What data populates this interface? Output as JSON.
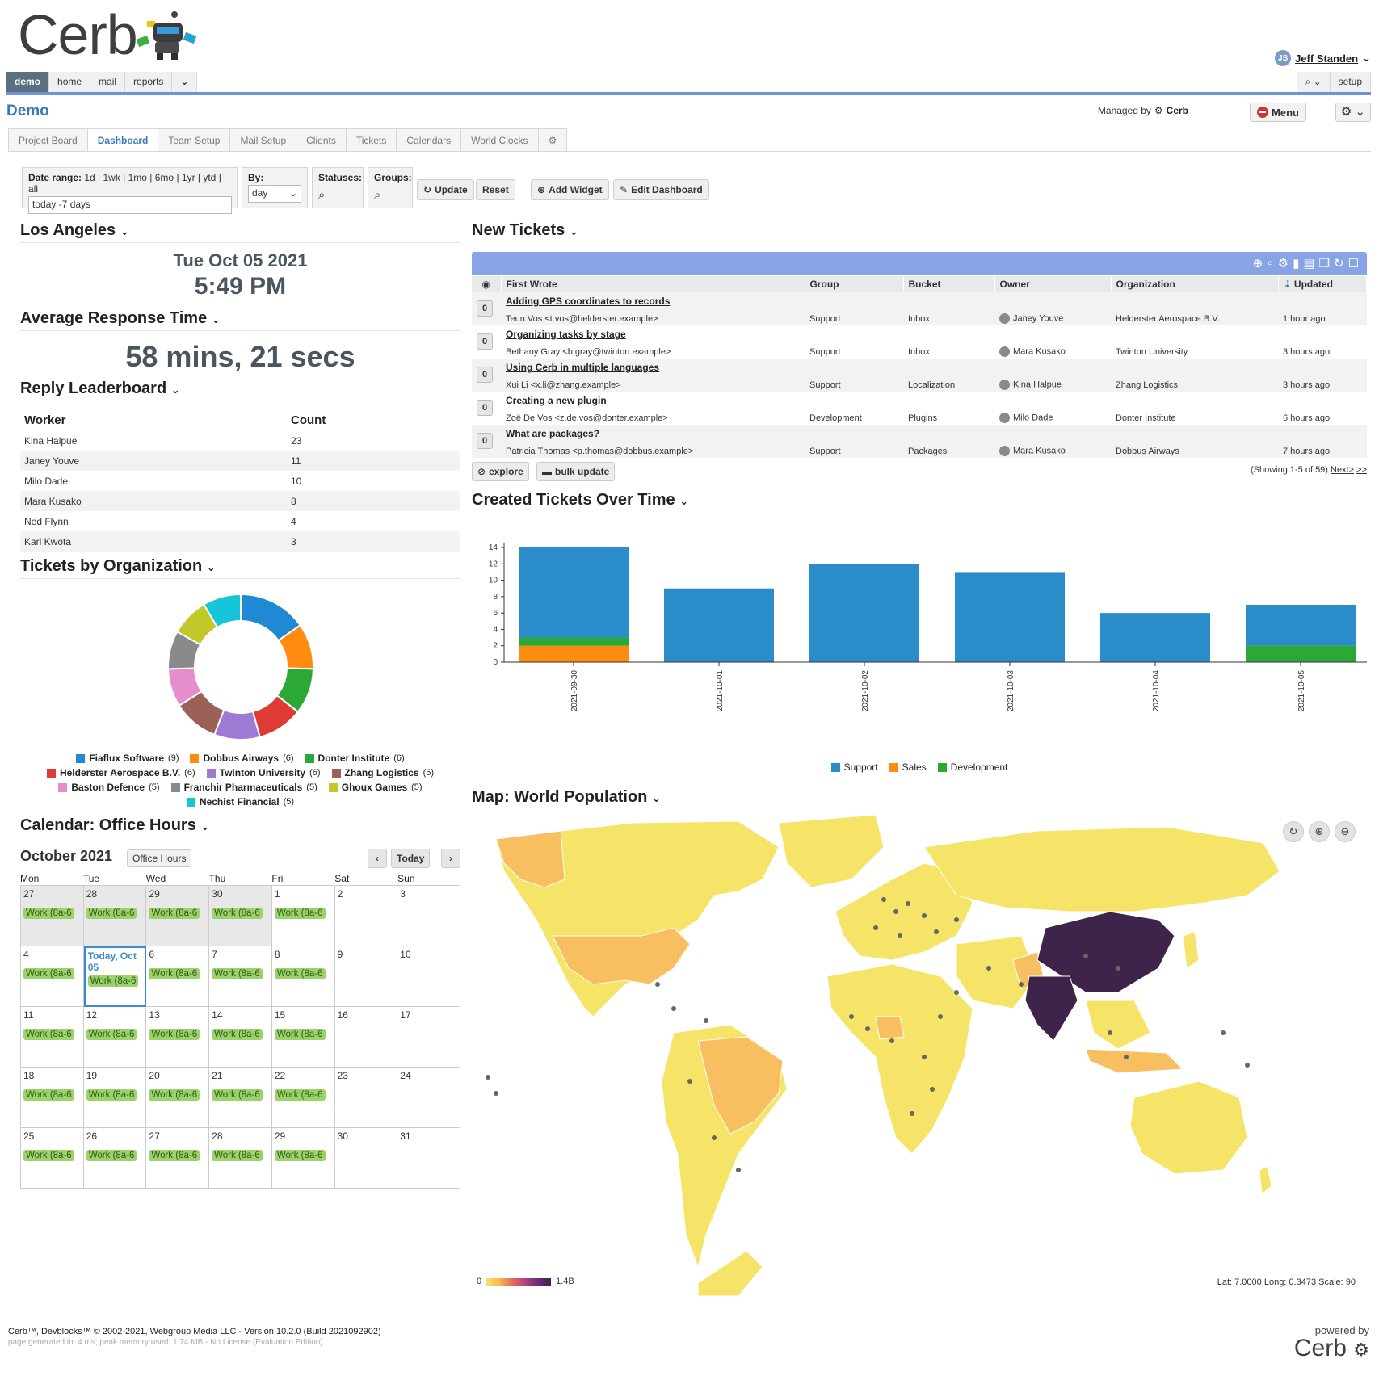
{
  "brand": {
    "logo_text": "Cerb",
    "powered_by": "powered by",
    "powered_logo": "Cerb"
  },
  "user": {
    "initials": "JS",
    "name": "Jeff Standen"
  },
  "nav": {
    "tabs": [
      "demo",
      "home",
      "mail",
      "reports"
    ],
    "search_icon": "search-icon",
    "setup_label": "setup"
  },
  "page": {
    "title": "Demo",
    "managed_by_label": "Managed by",
    "managed_by_name": "Cerb",
    "menu_label": "Menu"
  },
  "dashboard_tabs": [
    "Project Board",
    "Dashboard",
    "Team Setup",
    "Mail Setup",
    "Clients",
    "Tickets",
    "Calendars",
    "World Clocks"
  ],
  "filters": {
    "date_range_label": "Date range:",
    "date_range_presets": "1d | 1wk | 1mo | 6mo | 1yr | ytd | all",
    "date_range_value": "today -7 days",
    "by_label": "By:",
    "by_value": "day",
    "statuses_label": "Statuses:",
    "groups_label": "Groups:",
    "update_label": "Update",
    "reset_label": "Reset",
    "add_widget_label": "Add Widget",
    "edit_dashboard_label": "Edit Dashboard"
  },
  "clock": {
    "title": "Los Angeles",
    "date": "Tue Oct 05 2021",
    "time": "5:49 PM"
  },
  "avg_response": {
    "title": "Average Response Time",
    "value": "58 mins, 21 secs"
  },
  "leaderboard": {
    "title": "Reply Leaderboard",
    "columns": [
      "Worker",
      "Count"
    ],
    "rows": [
      [
        "Kina Halpue",
        "23"
      ],
      [
        "Janey Youve",
        "11"
      ],
      [
        "Milo Dade",
        "10"
      ],
      [
        "Mara Kusako",
        "8"
      ],
      [
        "Ned Flynn",
        "4"
      ],
      [
        "Karl Kwota",
        "3"
      ]
    ]
  },
  "orgs_widget": {
    "title": "Tickets by Organization"
  },
  "calendar": {
    "title": "Calendar: Office Hours",
    "month": "October 2021",
    "calendar_chip": "Office Hours",
    "today_label": "Today",
    "day_names": [
      "Mon",
      "Tue",
      "Wed",
      "Thu",
      "Fri",
      "Sat",
      "Sun"
    ],
    "today_text": "Today, Oct 05",
    "event_label": "Work (8a-6",
    "weeks": [
      [
        "27",
        "28",
        "29",
        "30",
        "1",
        "2",
        "3"
      ],
      [
        "4",
        "5",
        "6",
        "7",
        "8",
        "9",
        "10"
      ],
      [
        "11",
        "12",
        "13",
        "14",
        "15",
        "16",
        "17"
      ],
      [
        "18",
        "19",
        "20",
        "21",
        "22",
        "23",
        "24"
      ],
      [
        "25",
        "26",
        "27",
        "28",
        "29",
        "30",
        "31"
      ]
    ]
  },
  "tickets": {
    "title": "New Tickets",
    "columns": [
      "First Wrote",
      "Group",
      "Bucket",
      "Owner",
      "Organization",
      "Updated"
    ],
    "rows": [
      {
        "badge": "0",
        "subject": "Adding GPS coordinates to records",
        "from": "Teun Vos <t.vos@helderster.example>",
        "group": "Support",
        "bucket": "Inbox",
        "owner": "Janey Youve",
        "org": "Helderster Aerospace B.V.",
        "updated": "1 hour ago"
      },
      {
        "badge": "0",
        "subject": "Organizing tasks by stage",
        "from": "Bethany Gray <b.gray@twinton.example>",
        "group": "Support",
        "bucket": "Inbox",
        "owner": "Mara Kusako",
        "org": "Twinton University",
        "updated": "3 hours ago"
      },
      {
        "badge": "0",
        "subject": "Using Cerb in multiple languages",
        "from": "Xui Li <x.li@zhang.example>",
        "group": "Support",
        "bucket": "Localization",
        "owner": "Kina Halpue",
        "org": "Zhang Logistics",
        "updated": "3 hours ago"
      },
      {
        "badge": "0",
        "subject": "Creating a new plugin",
        "from": "Zoë De Vos <z.de.vos@donter.example>",
        "group": "Development",
        "bucket": "Plugins",
        "owner": "Milo Dade",
        "org": "Donter Institute",
        "updated": "6 hours ago"
      },
      {
        "badge": "0",
        "subject": "What are packages?",
        "from": "Patricia Thomas <p.thomas@dobbus.example>",
        "group": "Support",
        "bucket": "Packages",
        "owner": "Mara Kusako",
        "org": "Dobbus Airways",
        "updated": "7 hours ago"
      }
    ],
    "explore_label": "explore",
    "bulk_update_label": "bulk update",
    "paging_text": "(Showing 1-5 of 59)",
    "next_label": "Next>",
    "last_label": ">>"
  },
  "created_chart": {
    "title": "Created Tickets Over Time"
  },
  "map": {
    "title": "Map: World Population",
    "scale_min": "0",
    "scale_max": "1.4B",
    "coords_text": "Lat: 7.0000 Long: 0.3473 Scale: 90"
  },
  "footer": {
    "line1": "Cerb™, Devblocks™ © 2002-2021, Webgroup Media LLC - Version 10.2.0 (Build 2021092902)",
    "line2": "page generated in: 4 ms; peak memory used: 1.74 MB - No License (Evaluation Edition)"
  },
  "colors": {
    "accent_blue": "#3a7ab9",
    "nav_underline": "#6d93dd",
    "support": "#2a8cc9",
    "sales": "#ff8c11",
    "development": "#2ca837"
  },
  "chart_data": [
    {
      "type": "pie",
      "title": "",
      "categories": [
        "Fiaflux Software",
        "Dobbus Airways",
        "Donter Institute",
        "Helderster Aerospace B.V.",
        "Twinton University",
        "Zhang Logistics",
        "Baston Defence",
        "Franchir Pharmaceuticals",
        "Ghoux Games",
        "Nechist Financial"
      ],
      "values": [
        9,
        6,
        6,
        6,
        6,
        6,
        5,
        5,
        5,
        5
      ],
      "colors": [
        "#1f8ad3",
        "#ff8c11",
        "#2ca837",
        "#e03a35",
        "#9d7ad3",
        "#9b6056",
        "#e68dcc",
        "#8a8a8a",
        "#c2c72a",
        "#17c5d8"
      ],
      "legend_placement": "bottom"
    },
    {
      "type": "bar",
      "stacked": true,
      "title": "",
      "categories": [
        "2021-09-30",
        "2021-10-01",
        "2021-10-02",
        "2021-10-03",
        "2021-10-04",
        "2021-10-05"
      ],
      "series": [
        {
          "name": "Support",
          "color": "#2a8cc9",
          "values": [
            11,
            9,
            12,
            11,
            6,
            5
          ]
        },
        {
          "name": "Sales",
          "color": "#ff8c11",
          "values": [
            2,
            0,
            0,
            0,
            0,
            0
          ]
        },
        {
          "name": "Development",
          "color": "#2ca837",
          "values": [
            1,
            0,
            0,
            0,
            0,
            2
          ]
        }
      ],
      "yticks": [
        0,
        2,
        4,
        6,
        8,
        10,
        12,
        14
      ],
      "ylim": [
        0,
        14
      ],
      "grid": false,
      "legend_placement": "bottom"
    }
  ]
}
